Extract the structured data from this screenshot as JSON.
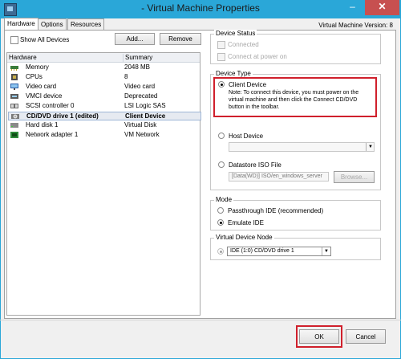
{
  "window": {
    "title": "- Virtual Machine Properties",
    "minimize": "–",
    "close": "✕"
  },
  "tabs": [
    "Hardware",
    "Options",
    "Resources"
  ],
  "vm_version": "Virtual Machine Version: 8",
  "show_all_devices": {
    "label": "Show All Devices",
    "checked": false
  },
  "buttons": {
    "add": "Add...",
    "remove": "Remove",
    "ok": "OK",
    "cancel": "Cancel",
    "browse": "Browse..."
  },
  "hardware_table": {
    "columns": [
      "Hardware",
      "Summary"
    ],
    "rows": [
      {
        "name": "Memory",
        "summary": "2048 MB",
        "icon": "memory-icon"
      },
      {
        "name": "CPUs",
        "summary": "8",
        "icon": "cpu-icon"
      },
      {
        "name": "Video card",
        "summary": "Video card",
        "icon": "monitor-icon"
      },
      {
        "name": "VMCI device",
        "summary": "Deprecated",
        "icon": "device-icon"
      },
      {
        "name": "SCSI controller 0",
        "summary": "LSI Logic SAS",
        "icon": "controller-icon"
      },
      {
        "name": "CD/DVD drive 1 (edited)",
        "summary": "Client Device",
        "icon": "cd-drive-icon",
        "selected": true
      },
      {
        "name": "Hard disk 1",
        "summary": "Virtual Disk",
        "icon": "disk-icon"
      },
      {
        "name": "Network adapter 1",
        "summary": "VM Network",
        "icon": "network-icon"
      }
    ]
  },
  "device_status": {
    "title": "Device Status",
    "connected": "Connected",
    "connect_at_power_on": "Connect at power on"
  },
  "device_type": {
    "title": "Device Type",
    "client_device": "Client Device",
    "note": [
      "Note: To connect this device, you must power on the",
      "virtual machine and then click the Connect CD/DVD",
      "button in the toolbar."
    ],
    "host_device": "Host Device",
    "host_device_value": "",
    "datastore_iso": "Datastore ISO File",
    "iso_path": "[Data(WD)] ISO/en_windows_server"
  },
  "mode": {
    "title": "Mode",
    "passthrough": "Passthrough IDE (recommended)",
    "emulate": "Emulate IDE"
  },
  "virtual_device_node": {
    "title": "Virtual Device Node",
    "value": "IDE (1:0) CD/DVD drive 1"
  },
  "colors": {
    "titlebar": "#2aa7d8",
    "highlight": "#d0202c",
    "selection": "#e6eaf1"
  }
}
